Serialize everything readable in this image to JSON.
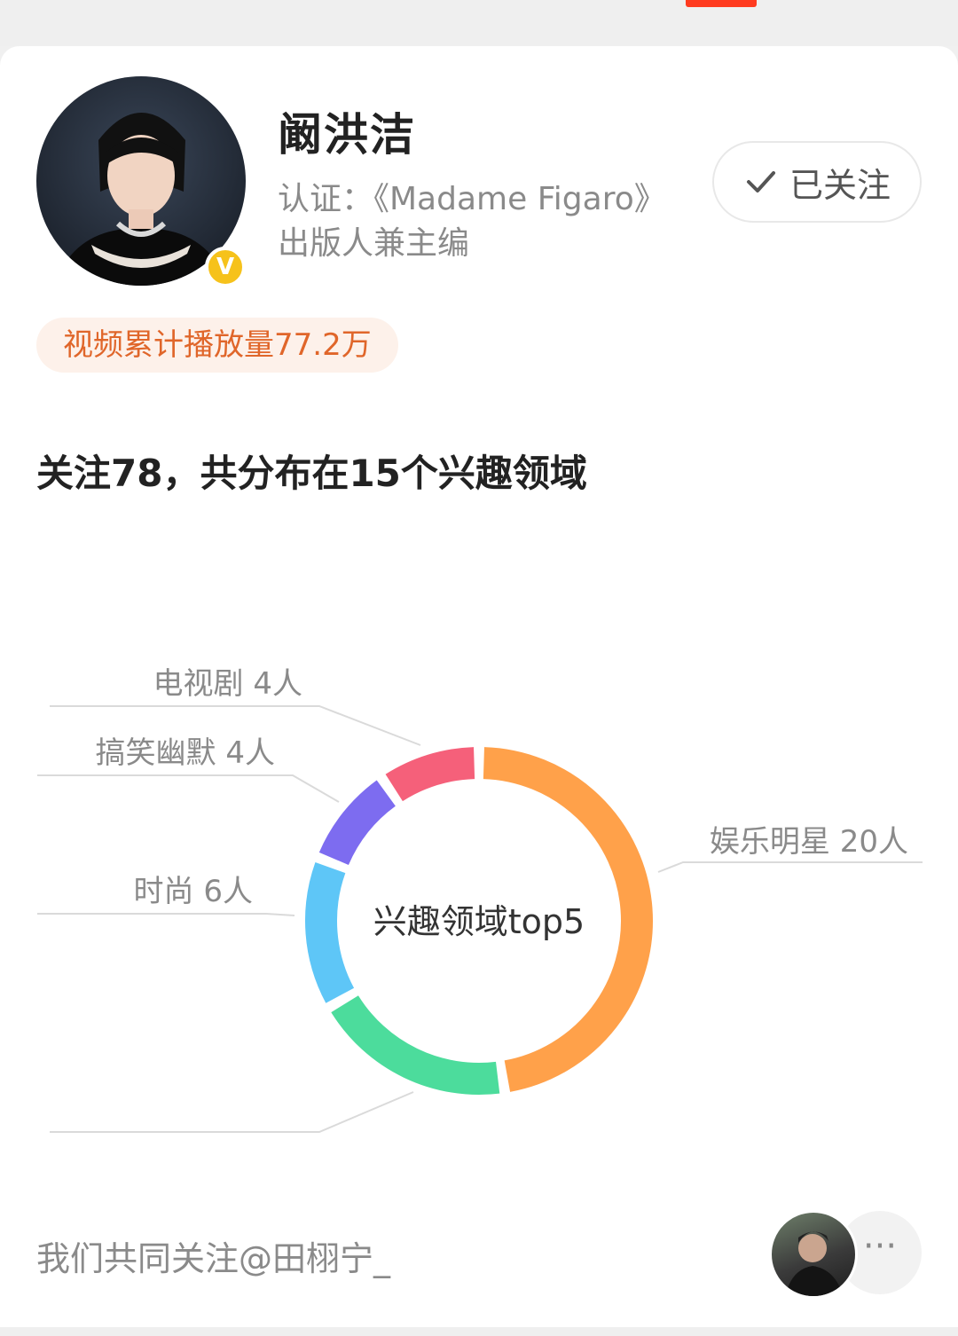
{
  "profile": {
    "name": "阚洪洁",
    "cert_line1": "认证：《Madame Figaro》",
    "cert_line2": "出版人兼主编",
    "verified_badge": "V",
    "follow_label": "已关注",
    "play_count_label": "视频累计播放量77.2万"
  },
  "interests": {
    "summary": "关注78，共分布在15个兴趣领域",
    "center_label": "兴趣领域top5"
  },
  "chart_data": {
    "type": "pie",
    "categories": [
      "娱乐明星",
      "",
      "时尚",
      "搞笑幽默",
      "电视剧"
    ],
    "values": [
      20,
      8,
      6,
      4,
      4
    ],
    "labels": [
      "娱乐明星 20人",
      "",
      "时尚 6人",
      "搞笑幽默 4人",
      "电视剧 4人"
    ],
    "colors": [
      "#ffa14a",
      "#4cdc9c",
      "#5ec6f7",
      "#7d6cf0",
      "#f5607a"
    ]
  },
  "mutual": {
    "text": "我们共同关注@田栩宁_",
    "more_icon": "···"
  },
  "icons": {
    "check": "check-icon",
    "more": "more-dots-icon"
  },
  "colors": {
    "accent": "#e0662a",
    "badge": "#f6c21b"
  }
}
